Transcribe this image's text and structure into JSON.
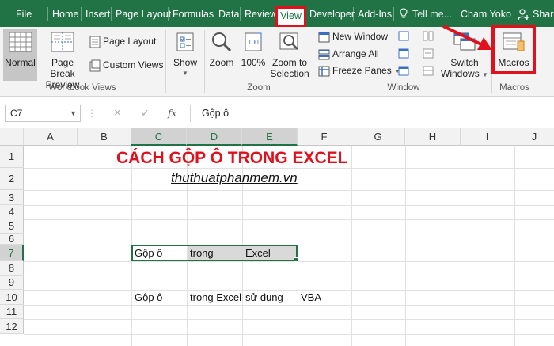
{
  "tabs": {
    "file": "File",
    "home": "Home",
    "insert": "Insert",
    "page_layout": "Page Layout",
    "formulas": "Formulas",
    "data": "Data",
    "review": "Review",
    "view": "View",
    "developer": "Developer",
    "addins": "Add-Ins",
    "tell_me": "Tell me...",
    "user": "Cham Yoko",
    "share": "Share"
  },
  "ribbon": {
    "workbook_views": {
      "label": "Workbook Views",
      "normal": "Normal",
      "page_break_1": "Page Break",
      "page_break_2": "Preview",
      "page_layout": "Page Layout",
      "custom_views": "Custom Views"
    },
    "show": {
      "label": "Show"
    },
    "zoom": {
      "label": "Zoom",
      "zoom": "Zoom",
      "hundred": "100%",
      "to_selection_1": "Zoom to",
      "to_selection_2": "Selection"
    },
    "window": {
      "label": "Window",
      "new_window": "New Window",
      "arrange_all": "Arrange All",
      "freeze_panes": "Freeze Panes",
      "switch_1": "Switch",
      "switch_2": "Windows"
    },
    "macros": {
      "label": "Macros",
      "button": "Macros"
    }
  },
  "formula_bar": {
    "name_box": "C7",
    "cancel": "×",
    "enter": "✓",
    "fx": "fx",
    "content": "Gộp ô"
  },
  "columns": [
    "A",
    "B",
    "C",
    "D",
    "E",
    "F",
    "G",
    "H",
    "I",
    "J"
  ],
  "rows": [
    "1",
    "2",
    "3",
    "4",
    "5",
    "6",
    "7",
    "8",
    "9",
    "10",
    "11",
    "12"
  ],
  "sheet": {
    "title": "CÁCH GỘP Ô TRONG EXCEL",
    "site": "thuthuatphanmem.vn",
    "row7": {
      "c": "Gộp ô",
      "d": "trong",
      "e": "Excel"
    },
    "row10": {
      "c": "Gộp ô",
      "d": "trong Excel",
      "e": "sử dụng",
      "f": "VBA"
    }
  },
  "colors": {
    "excel_green": "#217346",
    "highlight_red": "#e0101c",
    "ribbon_bg": "#f3f3f3"
  }
}
